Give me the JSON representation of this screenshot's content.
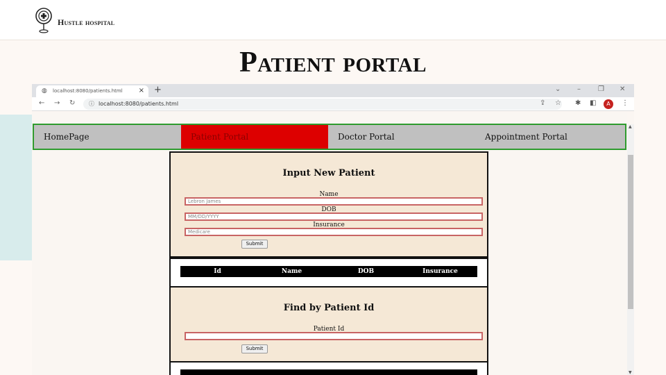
{
  "slide": {
    "brand": "Hustle hospital",
    "title": "Patient portal"
  },
  "browser": {
    "tab_title": "localhost:8080/patients.html",
    "url": "localhost:8080/patients.html",
    "avatar_letter": "A"
  },
  "nav": {
    "items": [
      "HomePage",
      "Patient Portal",
      "Doctor Portal",
      "Appointment Portal"
    ],
    "active": "Patient Portal"
  },
  "new_patient": {
    "title": "Input New Patient",
    "name_label": "Name",
    "name_value": "Lebron James",
    "dob_label": "DOB",
    "dob_placeholder": "MM/DD/YYYY",
    "insurance_label": "Insurance",
    "insurance_value": "Medicare",
    "submit_label": "Submit"
  },
  "patient_table": {
    "columns": [
      "Id",
      "Name",
      "DOB",
      "Insurance"
    ]
  },
  "find_patient": {
    "title": "Find by Patient Id",
    "id_label": "Patient Id",
    "id_value": "",
    "submit_label": "Submit"
  },
  "colors": {
    "nav_active": "#dd0000",
    "nav_border": "#2e9b2e",
    "panel_bg": "#f5e8d6",
    "avatar": "#c5221f"
  }
}
